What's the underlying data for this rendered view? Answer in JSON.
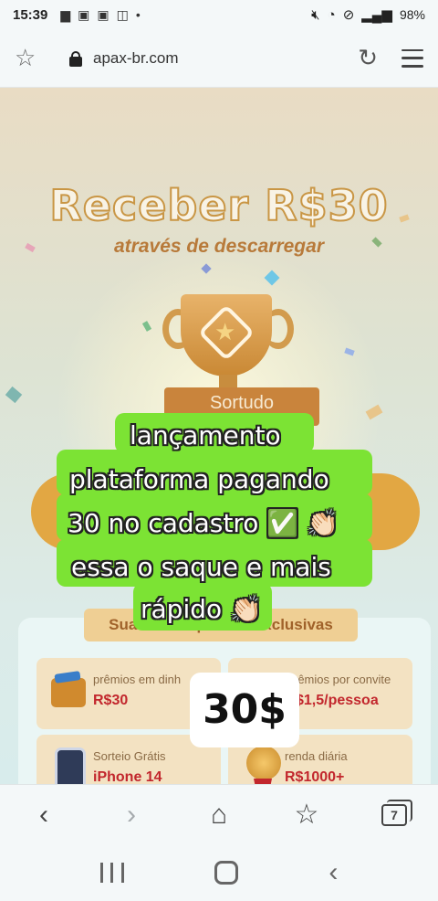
{
  "status_bar": {
    "time": "15:39",
    "battery": "98%",
    "notification_icons": [
      "message-icon",
      "gallery-icon",
      "gallery-icon",
      "screen-record-icon",
      "dot"
    ],
    "system_icons": [
      "mute-icon",
      "wifi-icon",
      "no-disturb-icon",
      "signal-icon"
    ]
  },
  "browser": {
    "url": "apax-br.com",
    "tab_count": "7"
  },
  "page": {
    "headline": "Receber R$30",
    "subheadline": "através de descarregar",
    "ribbon_text": "Sortudo",
    "rewards_title": "Suas recompensas exclusivas",
    "rewards": [
      {
        "label": "prêmios em dinh",
        "value": "R$30",
        "icon": "wallet-icon"
      },
      {
        "label": "rêmios por convite",
        "value": "$1,5/pessoa",
        "icon": "gift-icon"
      },
      {
        "label": "Sorteio Grátis",
        "value": "iPhone 14",
        "icon": "phone-icon"
      },
      {
        "label": "renda diária",
        "value": "R$1000+",
        "icon": "medal-icon"
      }
    ]
  },
  "overlay": {
    "caption_lines": [
      "lançamento",
      "plataforma pagando",
      "30 no cadastro ✅ 👏🏻",
      "essa o saque e mais",
      "rápido 👏🏻"
    ],
    "price_sticker": "30$"
  },
  "colors": {
    "caption_bg": "#7ce334",
    "headline_outline": "#c99645",
    "reward_value": "#c2272d"
  }
}
